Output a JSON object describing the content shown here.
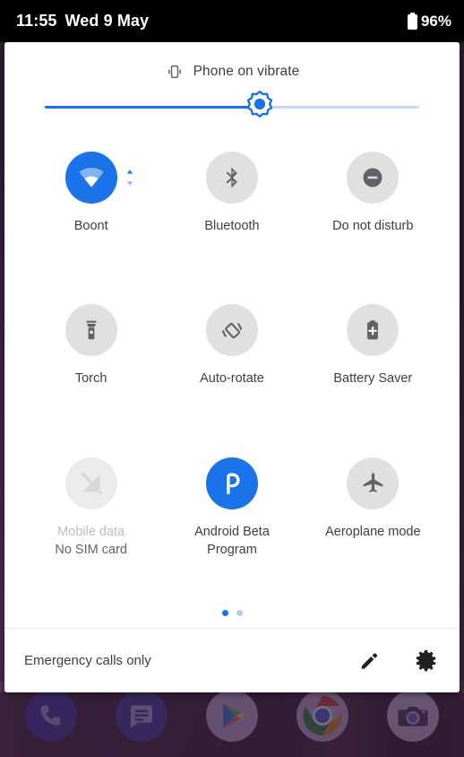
{
  "status_bar": {
    "time": "11:55",
    "date": "Wed 9 May",
    "battery_percent": "96%",
    "battery_icon": "battery-icon"
  },
  "quick_settings": {
    "header": {
      "ringer_icon": "vibrate-icon",
      "ringer_text": "Phone on vibrate"
    },
    "brightness": {
      "icon": "brightness-sun-icon",
      "value_percent": 55,
      "track_color": "#c6dafc",
      "fill_color": "#1a73e8"
    },
    "tiles": [
      {
        "id": "wifi",
        "label": "Boont",
        "sub": "",
        "icon": "wifi-icon",
        "state": "active",
        "has_expand_caret": true
      },
      {
        "id": "bluetooth",
        "label": "Bluetooth",
        "sub": "",
        "icon": "bluetooth-icon",
        "state": "inactive",
        "has_expand_caret": false
      },
      {
        "id": "dnd",
        "label": "Do not disturb",
        "sub": "",
        "icon": "do-not-disturb-icon",
        "state": "inactive",
        "has_expand_caret": false
      },
      {
        "id": "torch",
        "label": "Torch",
        "sub": "",
        "icon": "torch-icon",
        "state": "inactive",
        "has_expand_caret": false
      },
      {
        "id": "auto-rotate",
        "label": "Auto-rotate",
        "sub": "",
        "icon": "auto-rotate-icon",
        "state": "inactive",
        "has_expand_caret": false
      },
      {
        "id": "battery-saver",
        "label": "Battery Saver",
        "sub": "",
        "icon": "battery-saver-icon",
        "state": "inactive",
        "has_expand_caret": false
      },
      {
        "id": "mobile-data",
        "label": "Mobile data",
        "sub": "No SIM card",
        "icon": "mobile-data-off-icon",
        "state": "disabled",
        "has_expand_caret": false
      },
      {
        "id": "android-beta-program",
        "label": "Android Beta\nProgram",
        "sub": "",
        "icon": "android-beta-icon",
        "state": "active",
        "has_expand_caret": false
      },
      {
        "id": "aeroplane-mode",
        "label": "Aeroplane mode",
        "sub": "",
        "icon": "aeroplane-icon",
        "state": "inactive",
        "has_expand_caret": false
      }
    ],
    "pages": {
      "count": 2,
      "active_index": 0,
      "active_color": "#1a73e8",
      "inactive_color": "#aecbfa"
    },
    "footer": {
      "carrier_text": "Emergency calls only",
      "edit_icon": "pencil-edit-icon",
      "settings_icon": "gear-settings-icon"
    }
  },
  "dock": {
    "apps": [
      {
        "id": "phone",
        "icon": "phone-icon"
      },
      {
        "id": "messages",
        "icon": "messages-icon"
      },
      {
        "id": "play-store",
        "icon": "play-store-icon"
      },
      {
        "id": "chrome",
        "icon": "chrome-icon"
      },
      {
        "id": "camera",
        "icon": "camera-icon"
      }
    ]
  },
  "colors": {
    "accent": "#1a73e8",
    "tile_inactive": "#e0e0e0",
    "text_primary": "#3c4043",
    "text_secondary": "#5f6368",
    "text_disabled": "#bdbdbd",
    "panel_bg": "#ffffff",
    "status_bar_bg": "#000000"
  }
}
